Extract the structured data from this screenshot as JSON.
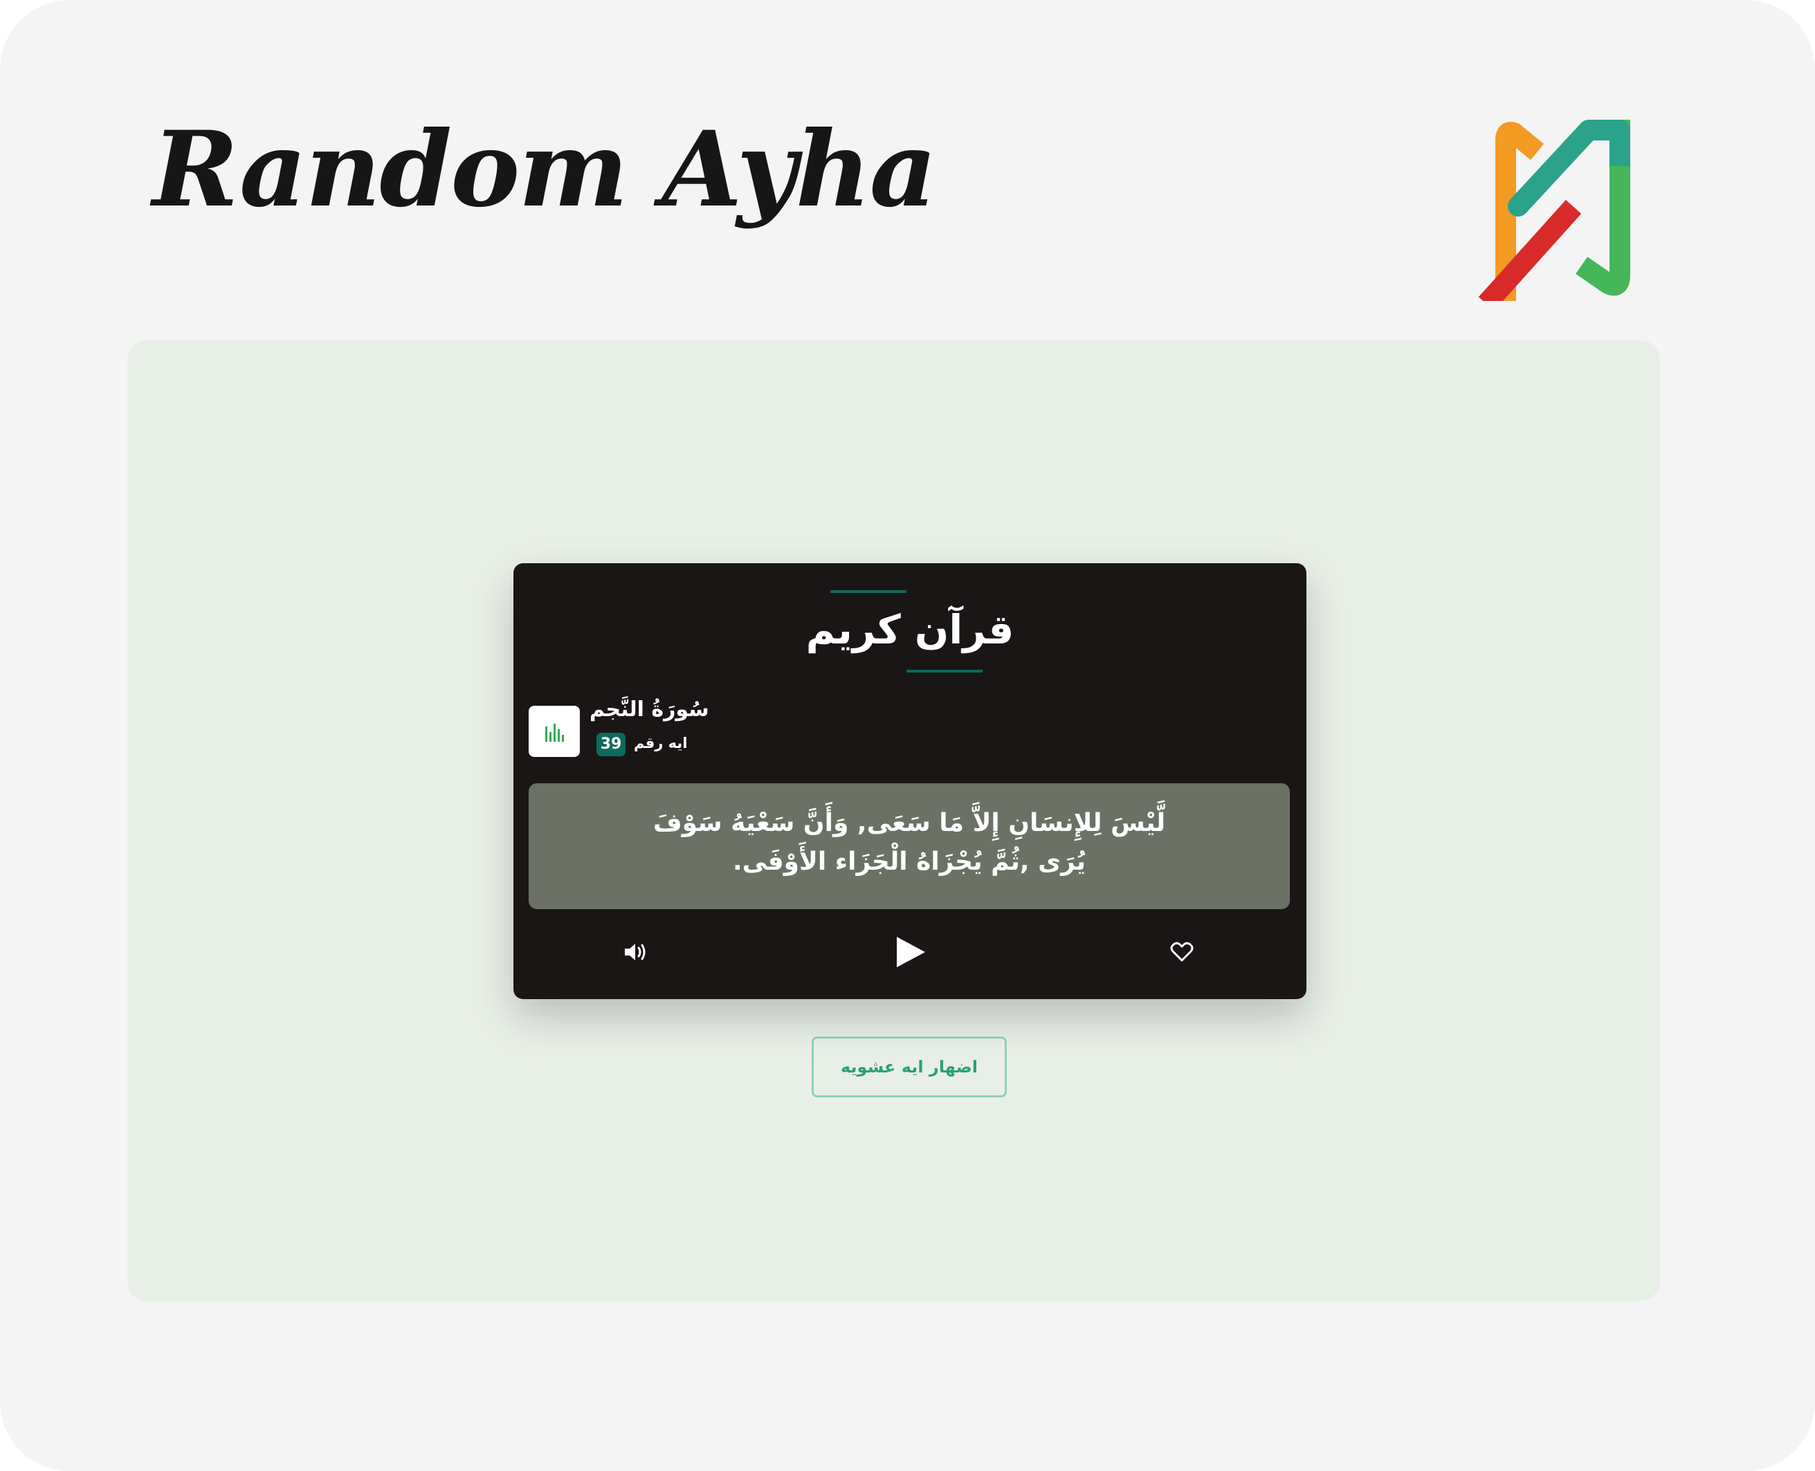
{
  "header": {
    "title": "Random Ayha",
    "logo_icon": "m-logo-icon"
  },
  "card": {
    "title": "قرآن كريم",
    "surah_icon": "bar-chart-icon",
    "surah_name": "سُورَةُ النَّجم",
    "ayah_label": "ايه رقم",
    "ayah_number": "39",
    "verse": "لَّيْسَ لِلإِنسَانِ إِلاَّ مَا سَعَى, وَأَنَّ سَعْيَهُ سَوْفَ يُرَى ,ثُمَّ يُجْزَاهُ الْجَزَاء الأَوْفَى.",
    "controls": {
      "volume_icon": "volume-icon",
      "play_icon": "play-icon",
      "like_icon": "heart-icon"
    }
  },
  "actions": {
    "random_label": "اضهار ايه عشويه"
  },
  "colors": {
    "frame_bg": "#f4f4f4",
    "panel_bg": "#e8efe7",
    "card_bg": "#1a1615",
    "accent": "#0e6a5c",
    "verse_bg": "#6b7165",
    "button_text": "#2e9e78",
    "button_border": "#8bd0b8",
    "logo_orange": "#f39a23",
    "logo_teal": "#2aa38a",
    "logo_red": "#d92a2a",
    "logo_green": "#45b65a"
  }
}
